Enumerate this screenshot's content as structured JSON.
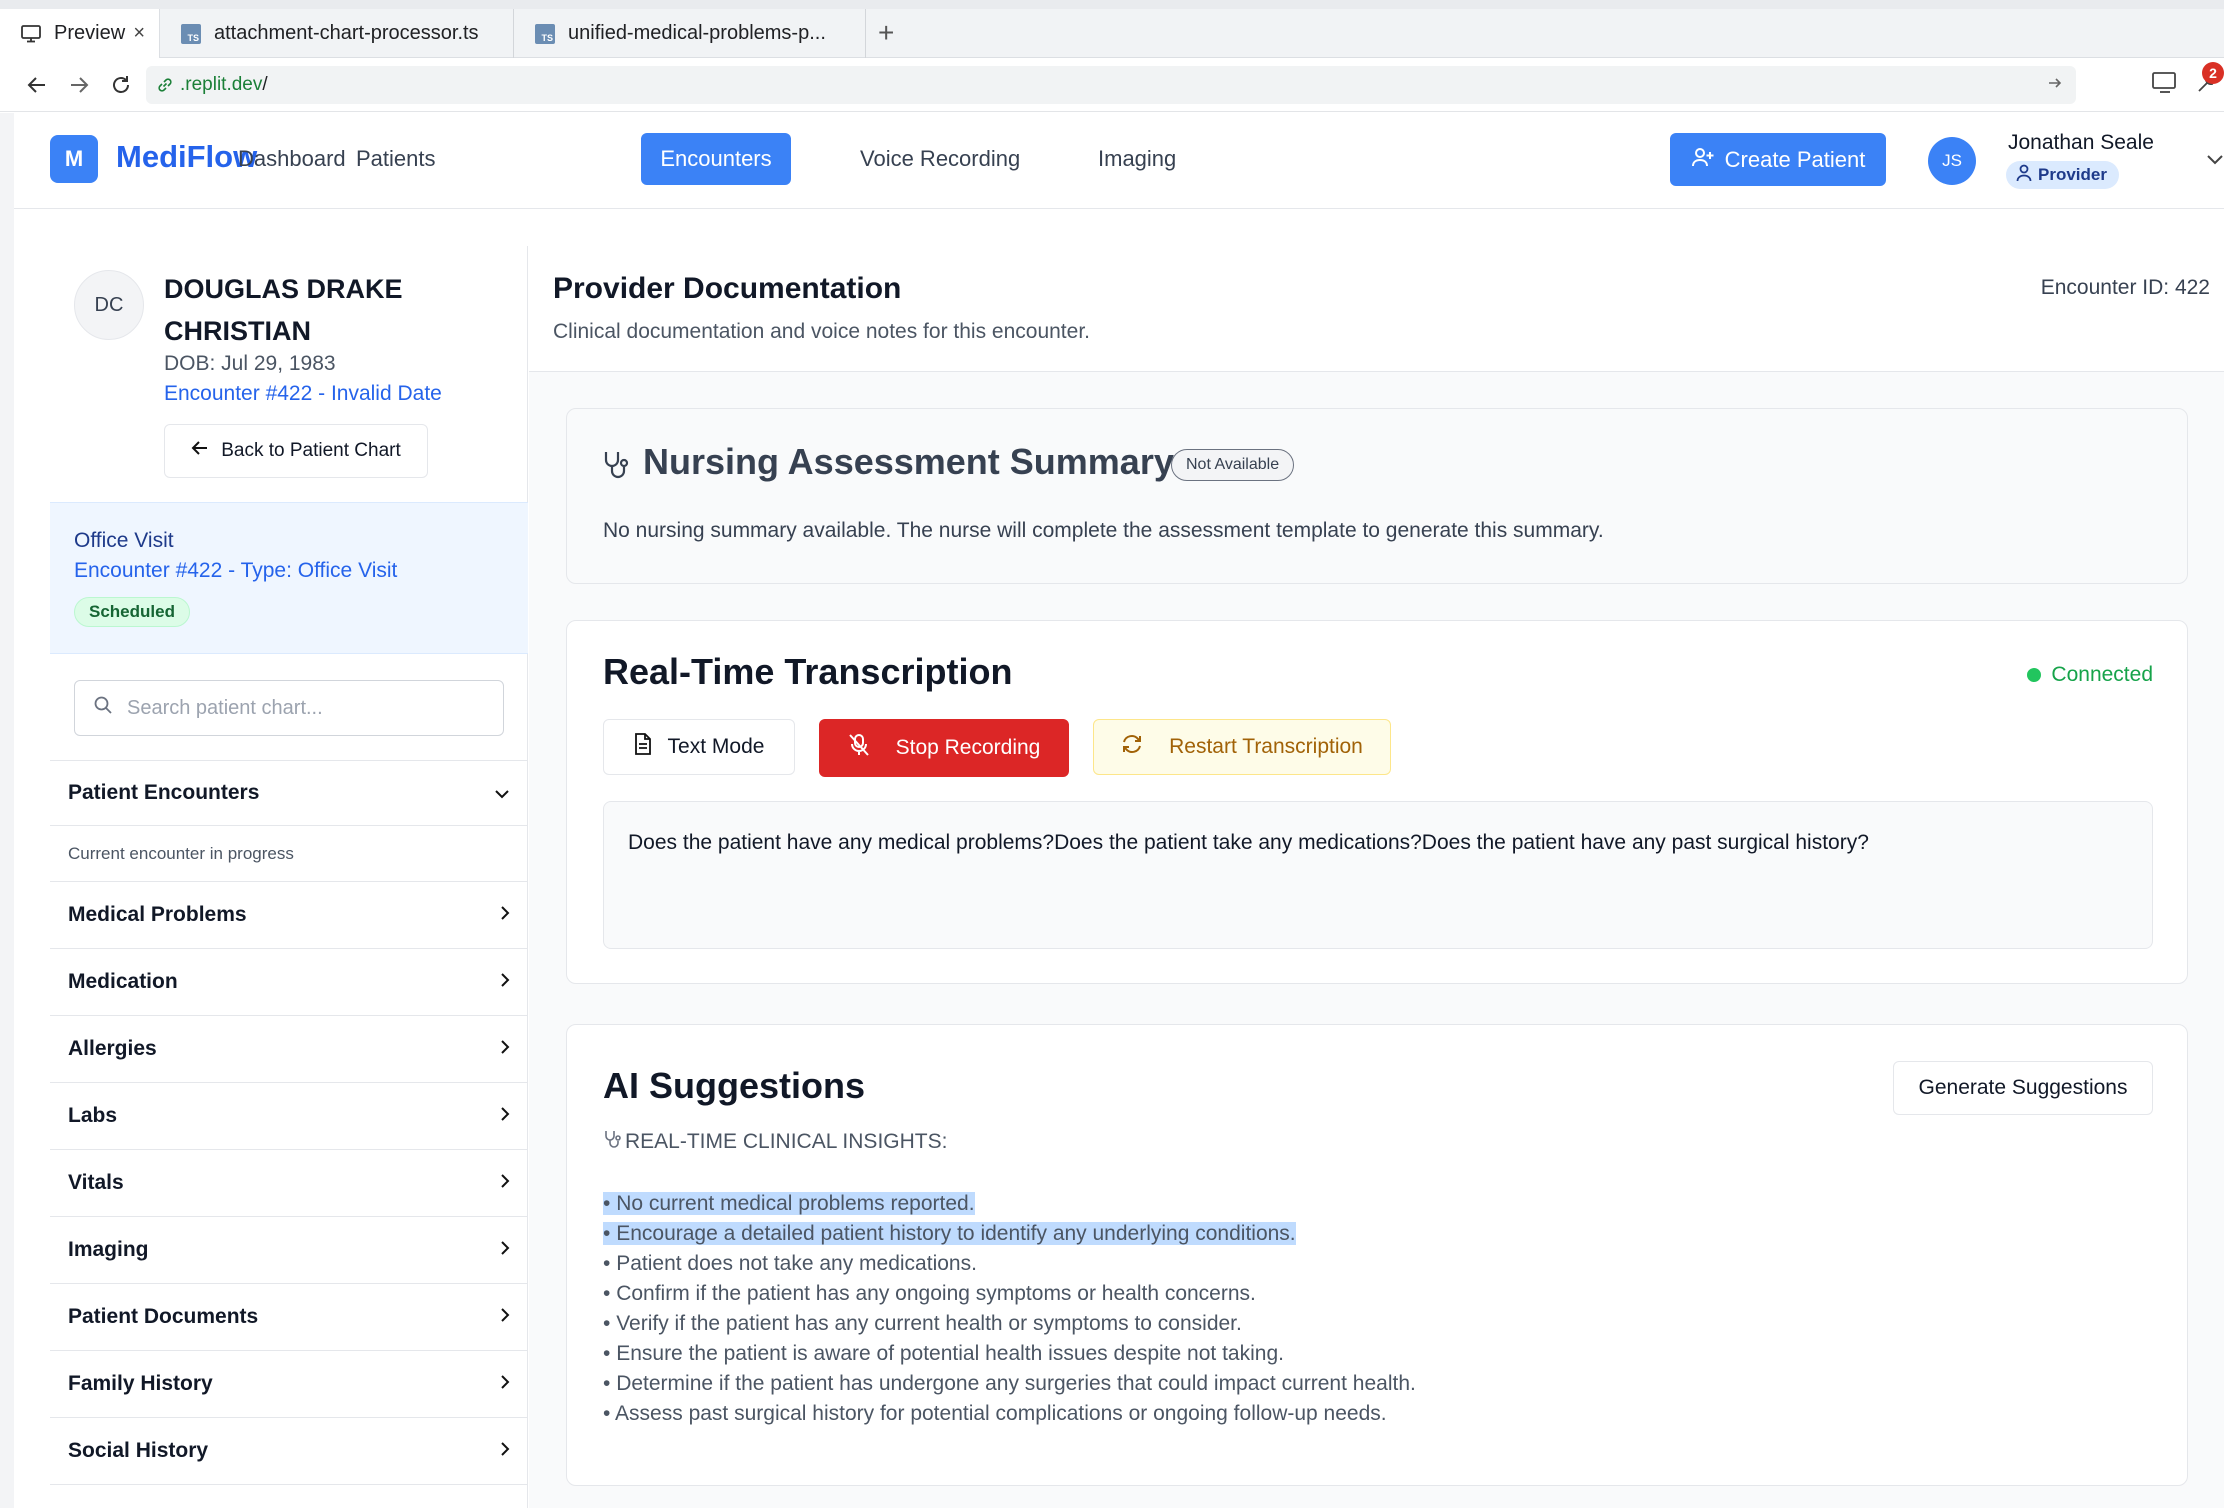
{
  "browser": {
    "tabs": [
      {
        "label": "Preview",
        "active": true
      },
      {
        "label": "attachment-chart-processor.ts",
        "active": false
      },
      {
        "label": "unified-medical-problems-p...",
        "active": false
      }
    ],
    "url_host": ".replit.dev",
    "url_path": "/",
    "notification_count": "2"
  },
  "header": {
    "logo_letter": "M",
    "brand": "MediFlow",
    "nav": [
      "Dashboard",
      "Patients",
      "Encounters",
      "Voice Recording",
      "Imaging"
    ],
    "active_nav": "Encounters",
    "create_button": "Create Patient",
    "user_initials": "JS",
    "user_name": "Jonathan Seale",
    "user_role": "Provider"
  },
  "patient": {
    "initials": "DC",
    "name": "DOUGLAS DRAKE CHRISTIAN",
    "dob": "DOB: Jul 29, 1983",
    "encounter_link": "Encounter #422 - Invalid Date",
    "back_button": "Back to Patient Chart"
  },
  "visit": {
    "title": "Office Visit",
    "subtitle": "Encounter #422 - Type: Office Visit",
    "status": "Scheduled"
  },
  "sidebar": {
    "search_placeholder": "Search patient chart...",
    "encounters_section": "Patient Encounters",
    "encounters_note": "Current encounter in progress",
    "sections": [
      "Medical Problems",
      "Medication",
      "Allergies",
      "Labs",
      "Vitals",
      "Imaging",
      "Patient Documents",
      "Family History",
      "Social History"
    ]
  },
  "main": {
    "title": "Provider Documentation",
    "subtitle": "Clinical documentation and voice notes for this encounter.",
    "encounter_id": "Encounter ID: 422"
  },
  "nursing": {
    "title": "Nursing Assessment Summary",
    "badge": "Not Available",
    "text": "No nursing summary available. The nurse will complete the assessment template to generate this summary."
  },
  "transcription": {
    "title": "Real-Time Transcription",
    "status": "Connected",
    "text_mode": "Text Mode",
    "stop": "Stop Recording",
    "restart": "Restart Transcription",
    "transcript": "Does the patient have any medical problems?Does the patient take any medications?Does the patient have any past surgical history?"
  },
  "ai": {
    "title": "AI Suggestions",
    "generate": "Generate Suggestions",
    "heading": "REAL-TIME CLINICAL INSIGHTS:",
    "lines": [
      "No current medical problems reported.",
      "Encourage a detailed patient history to identify any underlying conditions.",
      "Patient does not take any medications.",
      "Confirm if the patient has any ongoing symptoms or health concerns.",
      "Verify if the patient has any current health or symptoms to consider.",
      "Ensure the patient is aware of potential health issues despite not taking.",
      "Determine if the patient has undergone any surgeries that could impact current health.",
      "Assess past surgical history for potential complications or ongoing follow-up needs."
    ],
    "bullet": "•"
  },
  "colors": {
    "primary": "#3b82f6",
    "brand": "#2563eb",
    "danger": "#dc2626",
    "success": "#16a34a",
    "warning_text": "#a16207",
    "highlight": "#bfdbfe"
  }
}
